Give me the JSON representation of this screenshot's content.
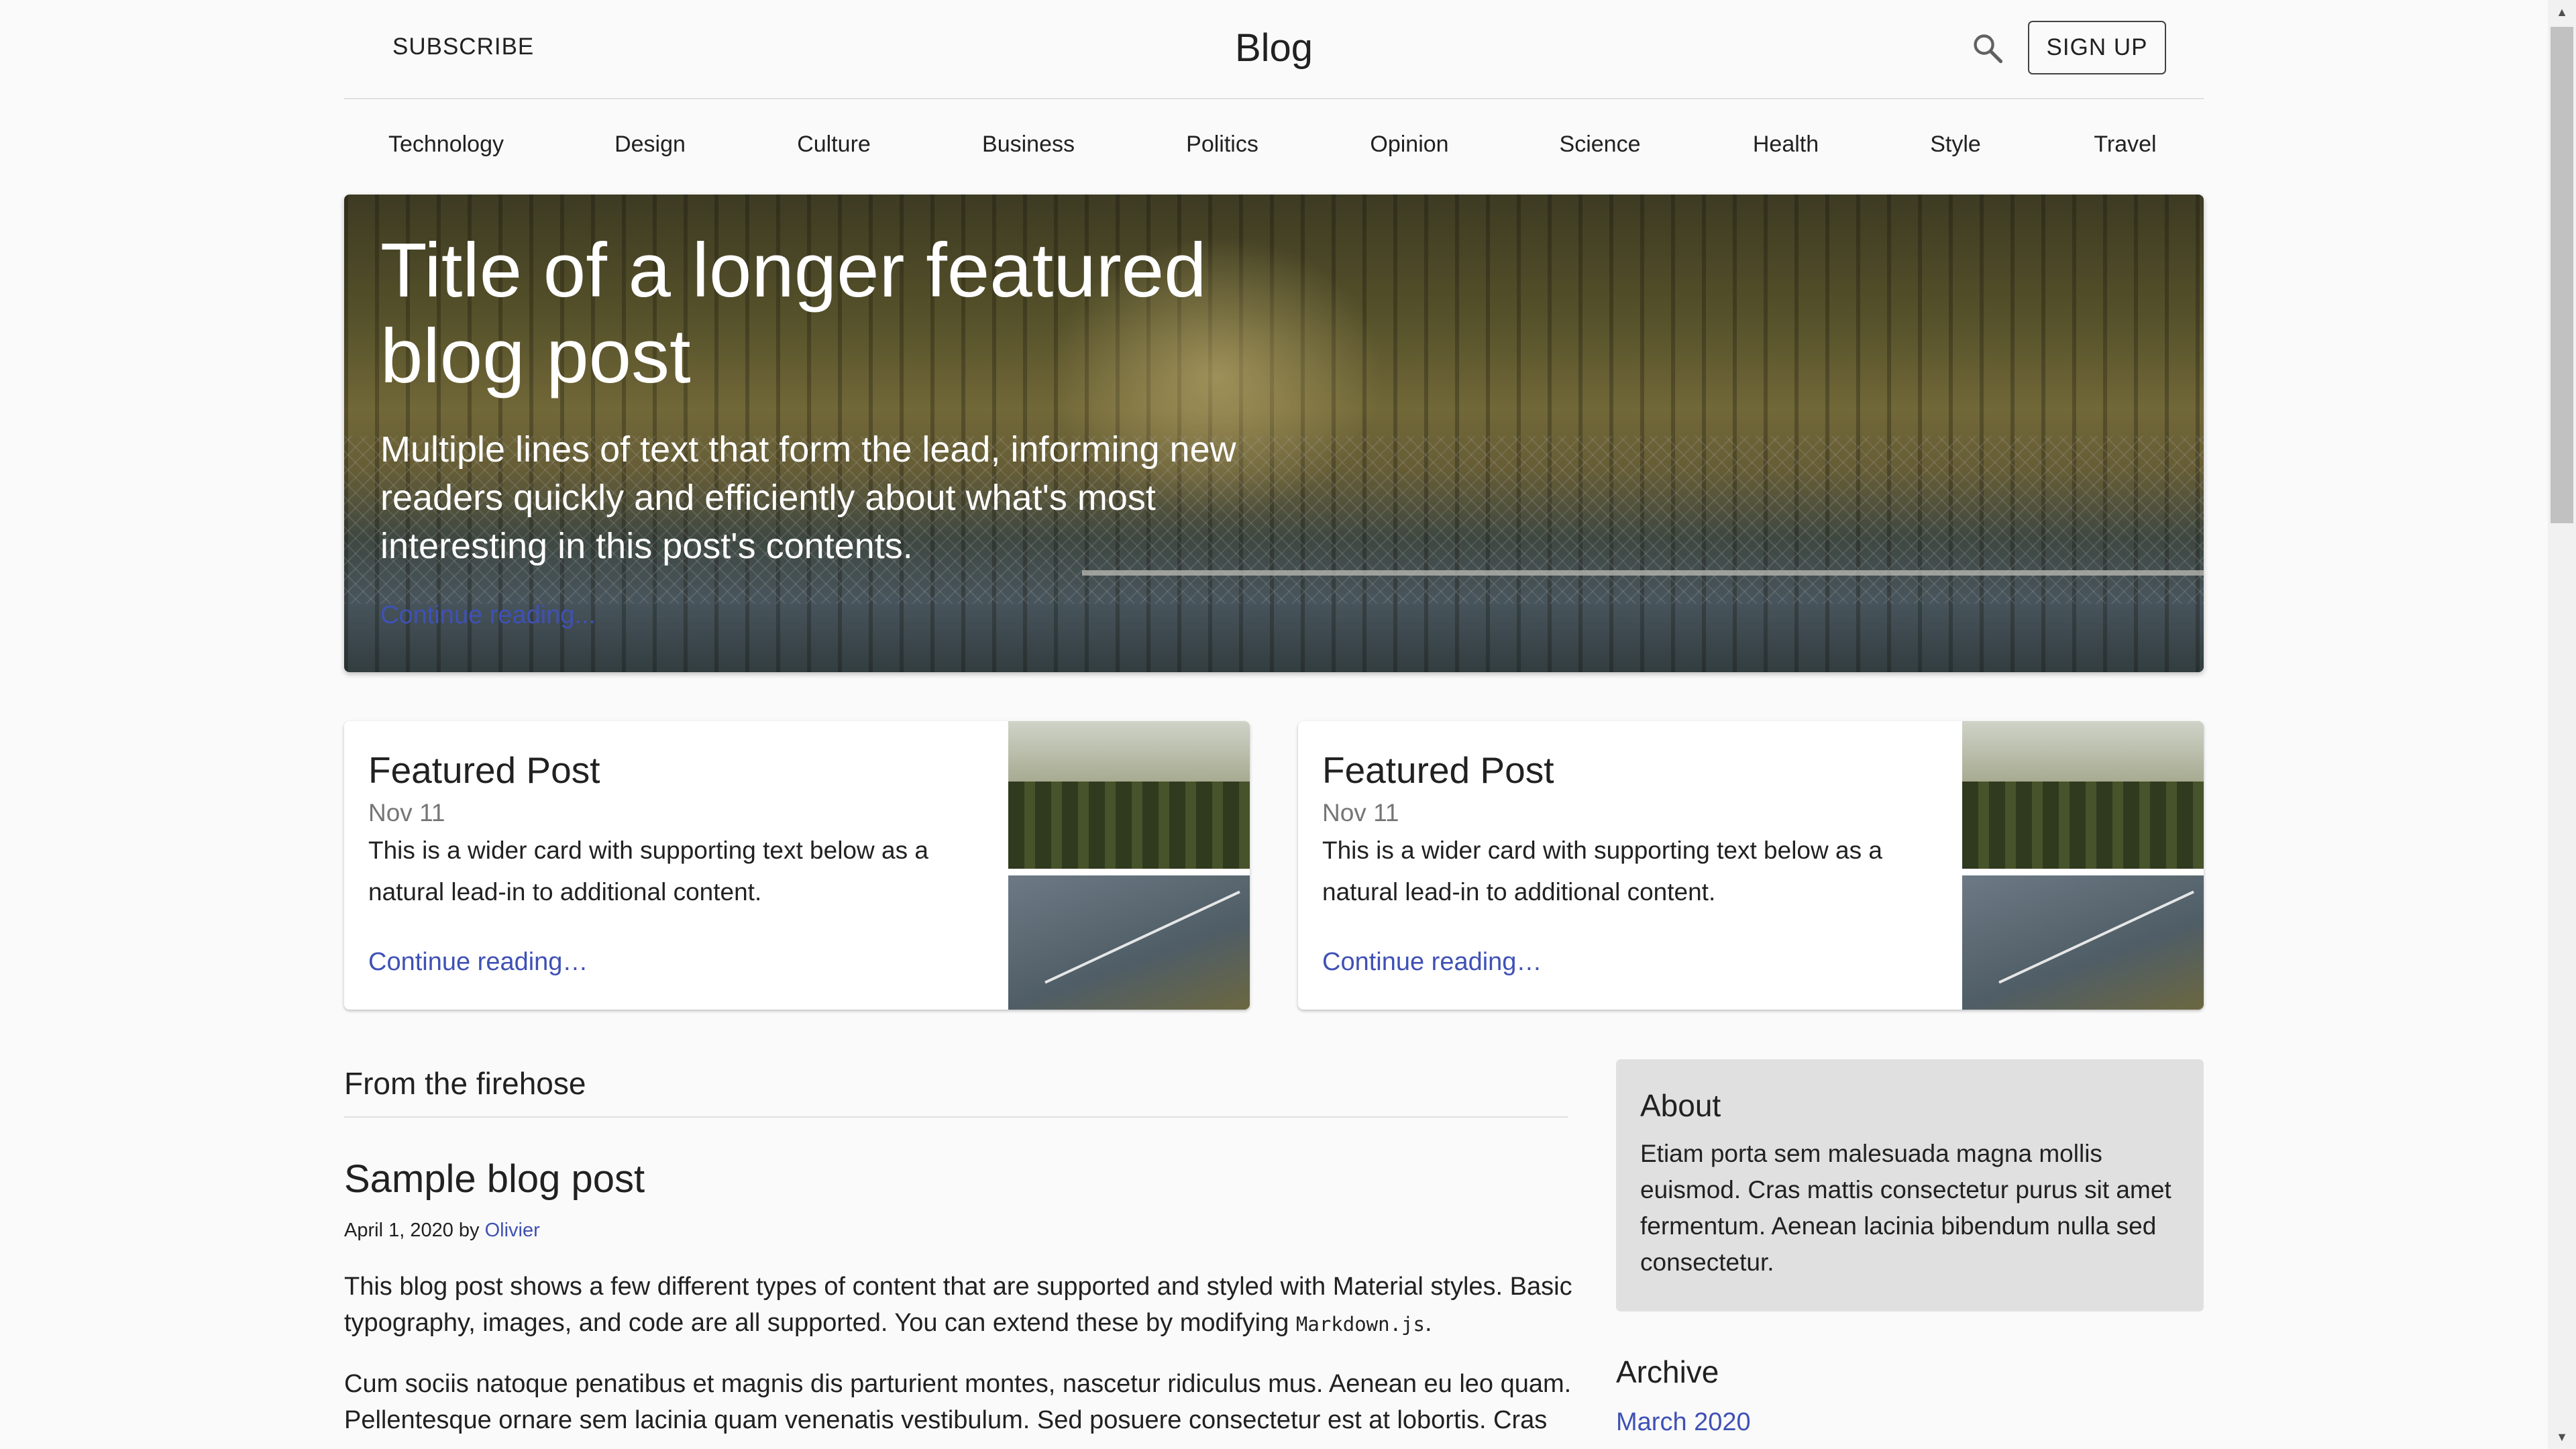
{
  "header": {
    "subscribe_label": "SUBSCRIBE",
    "brand": "Blog",
    "signup_label": "SIGN UP",
    "search_icon": "search-icon"
  },
  "nav": {
    "items": [
      {
        "label": "Technology"
      },
      {
        "label": "Design"
      },
      {
        "label": "Culture"
      },
      {
        "label": "Business"
      },
      {
        "label": "Politics"
      },
      {
        "label": "Opinion"
      },
      {
        "label": "Science"
      },
      {
        "label": "Health"
      },
      {
        "label": "Style"
      },
      {
        "label": "Travel"
      }
    ]
  },
  "hero": {
    "title": "Title of a longer featured blog post",
    "lead": "Multiple lines of text that form the lead, informing new readers quickly and efficiently about what's most interesting in this post's contents.",
    "link": "Continue reading..."
  },
  "featured": [
    {
      "title": "Featured Post",
      "date": "Nov 11",
      "description": "This is a wider card with supporting text below as a natural lead-in to additional content.",
      "link": "Continue reading…"
    },
    {
      "title": "Featured Post",
      "date": "Nov 11",
      "description": "This is a wider card with supporting text below as a natural lead-in to additional content.",
      "link": "Continue reading…"
    }
  ],
  "main": {
    "section_title": "From the firehose",
    "post": {
      "title": "Sample blog post",
      "date": "April 1, 2020 by ",
      "author": "Olivier",
      "p1": "This blog post shows a few different types of content that are supported and styled with Material styles. Basic typography, images, and code are all supported. You can extend these by modifying ",
      "p1_code": "Markdown.js",
      "p1_end": ".",
      "p2": "Cum sociis natoque penatibus et magnis dis parturient montes, nascetur ridiculus mus. Aenean eu leo quam. Pellentesque ornare sem lacinia quam venenatis vestibulum. Sed posuere consectetur est at lobortis. Cras"
    }
  },
  "sidebar": {
    "about_title": "About",
    "about_text": "Etiam porta sem malesuada magna mollis euismod. Cras mattis consectetur purus sit amet fermentum. Aenean lacinia bibendum nulla sed consectetur.",
    "archive_title": "Archive",
    "archive_items": [
      "March 2020"
    ]
  },
  "colors": {
    "accent": "#3f51b5",
    "background": "#fafafa",
    "about_bg": "#e0e0e0"
  }
}
